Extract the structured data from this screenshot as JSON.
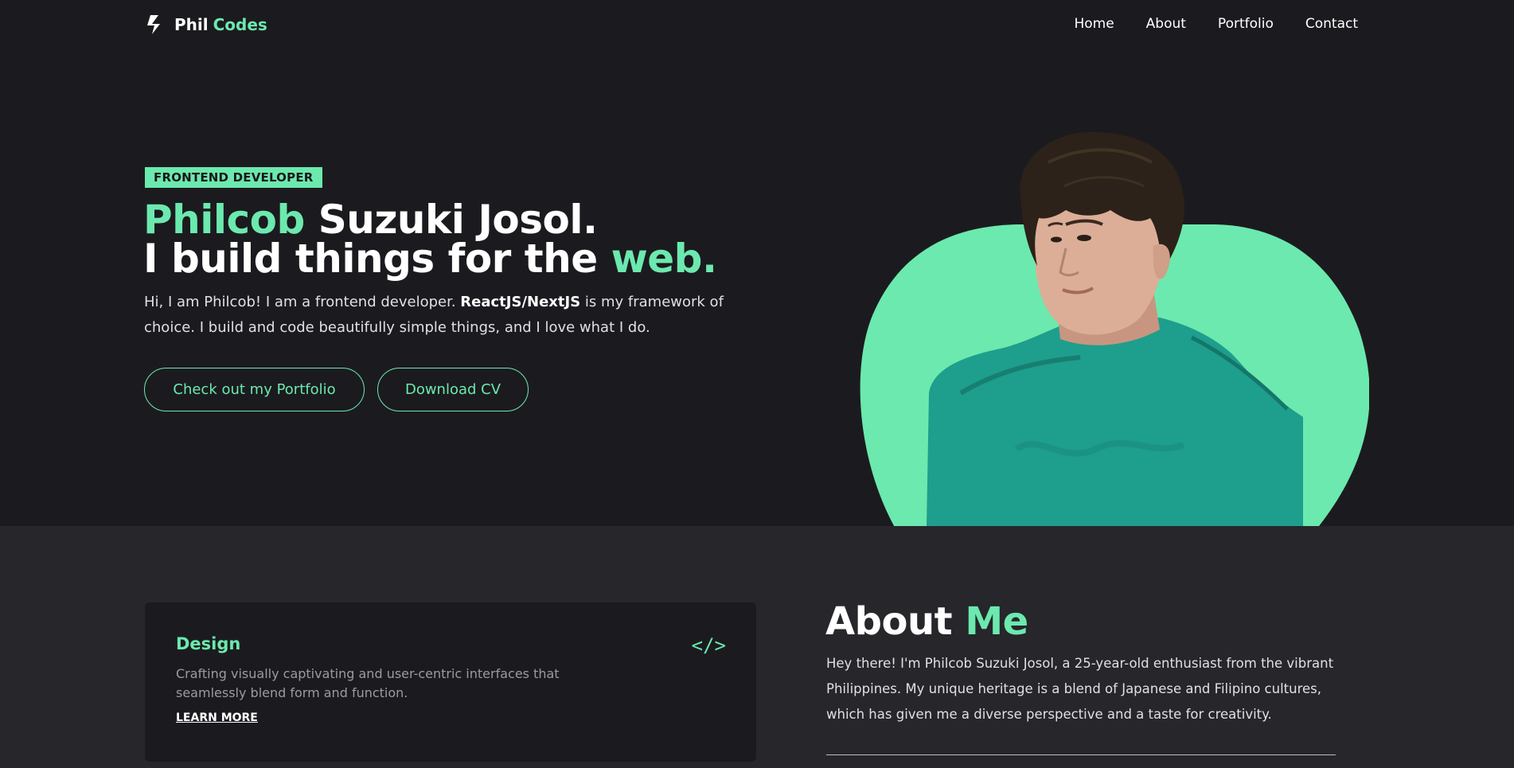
{
  "brand": {
    "first": "Phil",
    "second": "Codes",
    "icon": "bolt-s-logo-icon"
  },
  "nav": {
    "items": [
      "Home",
      "About",
      "Portfolio",
      "Contact"
    ]
  },
  "hero": {
    "badge": "FRONTEND DEVELOPER",
    "name_first": "Philcob",
    "name_rest": " Suzuki Josol.",
    "line2_start": "I build things for the ",
    "line2_accent": "web.",
    "intro_start": "Hi, I am Philcob! I am a frontend developer. ",
    "intro_bold": "ReactJS/NextJS",
    "intro_end": " is my framework of choice. I build and code beautifully simple things, and I love what I do.",
    "btn_portfolio": "Check out my Portfolio",
    "btn_cv": "Download CV",
    "photo_alt": "portrait-photo"
  },
  "card": {
    "title": "Design",
    "icon": "code-brackets-icon",
    "icon_glyph": "</>",
    "desc": "Crafting visually captivating and user-centric interfaces that seamlessly blend form and function.",
    "link": "LEARN MORE"
  },
  "about": {
    "title_start": "About ",
    "title_accent": "Me",
    "text": "Hey there! I'm Philcob Suzuki Josol, a 25-year-old enthusiast from the vibrant Philippines. My unique heritage is a blend of Japanese and Filipino cultures, which has given me a diverse perspective and a taste for creativity."
  },
  "colors": {
    "accent": "#6ce9ae",
    "background": "#1b1b1f",
    "section_bg": "#26262b",
    "shirt": "#1e9e8c"
  }
}
